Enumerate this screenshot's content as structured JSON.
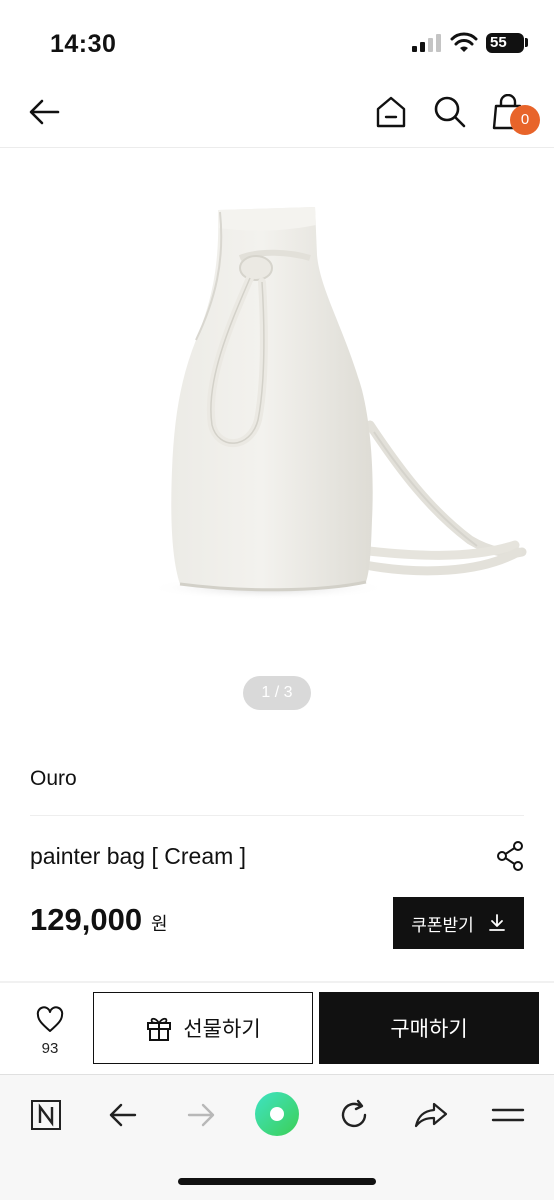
{
  "status_bar": {
    "time": "14:30",
    "battery": "55"
  },
  "header": {
    "cart_count": "0"
  },
  "gallery": {
    "pager": "1 / 3"
  },
  "product": {
    "brand": "Ouro",
    "name": "painter bag [ Cream ]",
    "price": "129,000",
    "price_unit": "원",
    "coupon_label": "쿠폰받기"
  },
  "actions": {
    "like_count": "93",
    "gift_label": "선물하기",
    "buy_label": "구매하기"
  },
  "icons": [
    "back-arrow-icon",
    "home-icon",
    "search-icon",
    "cart-icon",
    "share-icon",
    "download-icon",
    "heart-icon",
    "gift-icon",
    "naver-n-icon",
    "browser-back-icon",
    "browser-forward-icon",
    "green-dot-icon",
    "refresh-icon",
    "share-arrow-icon",
    "menu-icon"
  ],
  "colors": {
    "accent": "#e8642a",
    "primary": "#111111",
    "green": "#3dd98a"
  }
}
